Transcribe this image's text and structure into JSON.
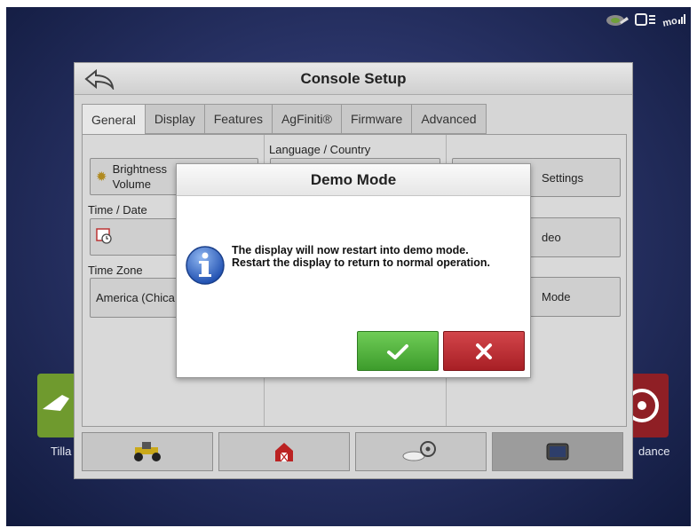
{
  "statusbar": {
    "icons": [
      "gps-status-icon",
      "display-icon",
      "wifi-signal-icon"
    ]
  },
  "background": {
    "left_tile_label": "Tilla",
    "right_tile_label": "dance"
  },
  "console": {
    "title": "Console Setup",
    "tabs": [
      {
        "label": "General",
        "active": true
      },
      {
        "label": "Display",
        "active": false
      },
      {
        "label": "Features",
        "active": false
      },
      {
        "label": "AgFiniti®",
        "active": false
      },
      {
        "label": "Firmware",
        "active": false
      },
      {
        "label": "Advanced",
        "active": false
      }
    ],
    "general": {
      "brightness_volume": "Brightness\nVolume",
      "time_date_label": "Time / Date",
      "time_zone_label": "Time Zone",
      "time_zone_value": "America (Chica",
      "language_label": "Language / Country",
      "settings_label": "Settings",
      "video_label": "deo",
      "mode_label": "Mode"
    },
    "bottom_buttons": [
      "equipment-button",
      "farm-button",
      "guidance-button",
      "display-button"
    ]
  },
  "dialog": {
    "title": "Demo Mode",
    "message": "The display will now restart into demo mode. Restart the display to return to normal operation.",
    "ok_color": "#4aa836",
    "cancel_color": "#b82a30"
  }
}
